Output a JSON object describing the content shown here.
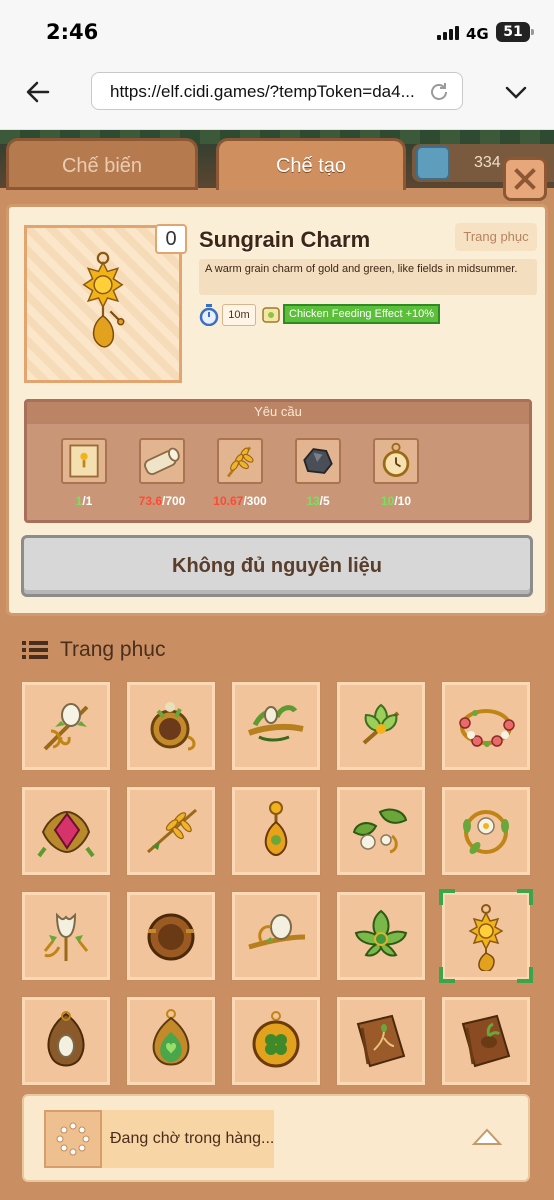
{
  "status_bar": {
    "time": "2:46",
    "network": "4G",
    "battery": "51"
  },
  "browser": {
    "url": "https://elf.cidi.games/?tempToken=da4..."
  },
  "tabs": [
    {
      "label": "Chế biến",
      "active": false
    },
    {
      "label": "Chế tạo",
      "active": true
    }
  ],
  "currency": {
    "count": "334"
  },
  "item": {
    "name": "Sungrain Charm",
    "owned": "0",
    "category": "Trang phục",
    "description": "A warm grain charm of gold and green, like fields in midsummer.",
    "craft_time": "10m",
    "effect": "Chicken Feeding Effect +10%"
  },
  "requirements": {
    "title": "Yêu cầu",
    "items": [
      {
        "icon": "recipe-scroll-icon",
        "have": "1",
        "need": "/1",
        "enough": true
      },
      {
        "icon": "wood-log-icon",
        "have": "73.6",
        "need": "/700",
        "enough": false
      },
      {
        "icon": "wheat-icon",
        "have": "10.67",
        "need": "/300",
        "enough": false
      },
      {
        "icon": "stone-ore-icon",
        "have": "13",
        "need": "/5",
        "enough": true
      },
      {
        "icon": "pocket-watch-icon",
        "have": "10",
        "need": "/10",
        "enough": true
      }
    ]
  },
  "craft_button": {
    "label": "Không đủ nguyên liệu"
  },
  "list": {
    "title": "Trang phục",
    "items": [
      {
        "icon": "flower-hairpin-icon"
      },
      {
        "icon": "bronze-brooch-icon"
      },
      {
        "icon": "leaf-hairclip-icon"
      },
      {
        "icon": "lotus-brooch-icon"
      },
      {
        "icon": "flower-bracelet-icon"
      },
      {
        "icon": "ruby-brooch-icon"
      },
      {
        "icon": "wheat-hairpin-icon"
      },
      {
        "icon": "amber-pendant-icon"
      },
      {
        "icon": "blossom-pin-icon"
      },
      {
        "icon": "wreath-brooch-icon"
      },
      {
        "icon": "tulip-hairpin-icon"
      },
      {
        "icon": "wooden-brooch-icon"
      },
      {
        "icon": "rose-hairclip-icon"
      },
      {
        "icon": "jade-leaf-brooch-icon"
      },
      {
        "icon": "sungrain-charm-icon",
        "selected": true
      },
      {
        "icon": "seed-amulet-icon"
      },
      {
        "icon": "heart-leaf-pendant-icon"
      },
      {
        "icon": "clover-medallion-icon"
      },
      {
        "icon": "root-book-icon"
      },
      {
        "icon": "sprout-book-icon"
      }
    ]
  },
  "queue": {
    "status": "Đang chờ trong hàng..."
  },
  "colors": {
    "accent": "#c98f62",
    "panel": "#fbeed7",
    "effect": "#5bbf3a"
  }
}
